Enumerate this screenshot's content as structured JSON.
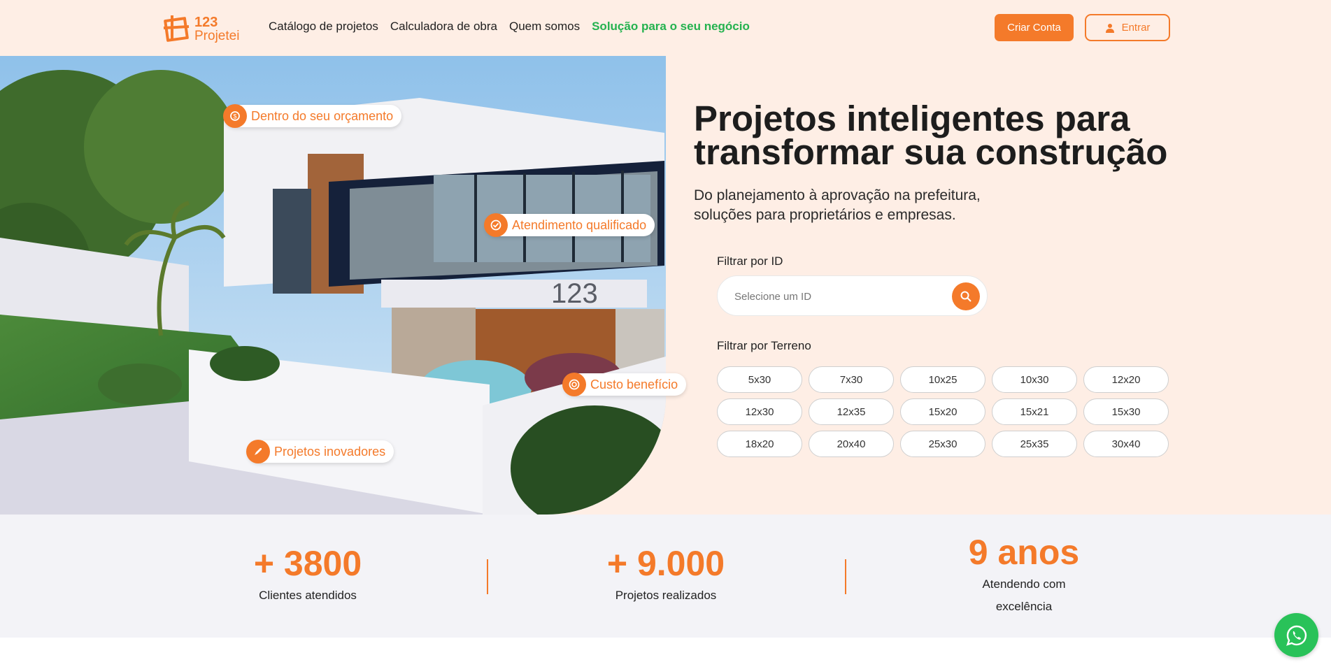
{
  "brand": {
    "number": "123",
    "name": "Projetei",
    "accent": "#f47a2a",
    "highlight": "#24b24f"
  },
  "nav": {
    "items": [
      {
        "label": "Catálogo de projetos"
      },
      {
        "label": "Calculadora de obra"
      },
      {
        "label": "Quem somos"
      },
      {
        "label": "Solução para o seu negócio"
      }
    ]
  },
  "auth": {
    "signup_label": "Criar Conta",
    "login_label": "Entrar",
    "login_icon": "user-icon"
  },
  "hero": {
    "title_bold": "Projetos inteligentes",
    "title_rest_1": " para",
    "title_line2": "transformar sua construção",
    "subtitle_line1": "Do planejamento à aprovação na prefeitura,",
    "subtitle_line2": "soluções para proprietários e empresas.",
    "house_number": "123",
    "badges": [
      {
        "label": "Dentro do seu orçamento",
        "icon": "budget-icon"
      },
      {
        "label": "Atendimento qualificado",
        "icon": "badge-check-icon"
      },
      {
        "label": "Custo benefício",
        "icon": "cost-icon"
      },
      {
        "label": "Projetos inovadores",
        "icon": "rocket-icon"
      }
    ]
  },
  "filters": {
    "id_label": "Filtrar por ID",
    "id_placeholder": "Selecione um ID",
    "search_icon": "search-icon",
    "terrain_label": "Filtrar por Terreno",
    "terrains": [
      "5x30",
      "7x30",
      "10x25",
      "10x30",
      "12x20",
      "12x30",
      "12x35",
      "15x20",
      "15x21",
      "15x30",
      "18x20",
      "20x40",
      "25x30",
      "25x35",
      "30x40"
    ]
  },
  "stats": [
    {
      "value": "+ 3800",
      "label": "Clientes atendidos"
    },
    {
      "value": "+ 9.000",
      "label": "Projetos realizados"
    },
    {
      "value": "9 anos",
      "label_line1": "Atendendo com",
      "label_line2": "excelência"
    }
  ],
  "whatsapp": {
    "icon": "whatsapp-icon",
    "color": "#29c259"
  }
}
